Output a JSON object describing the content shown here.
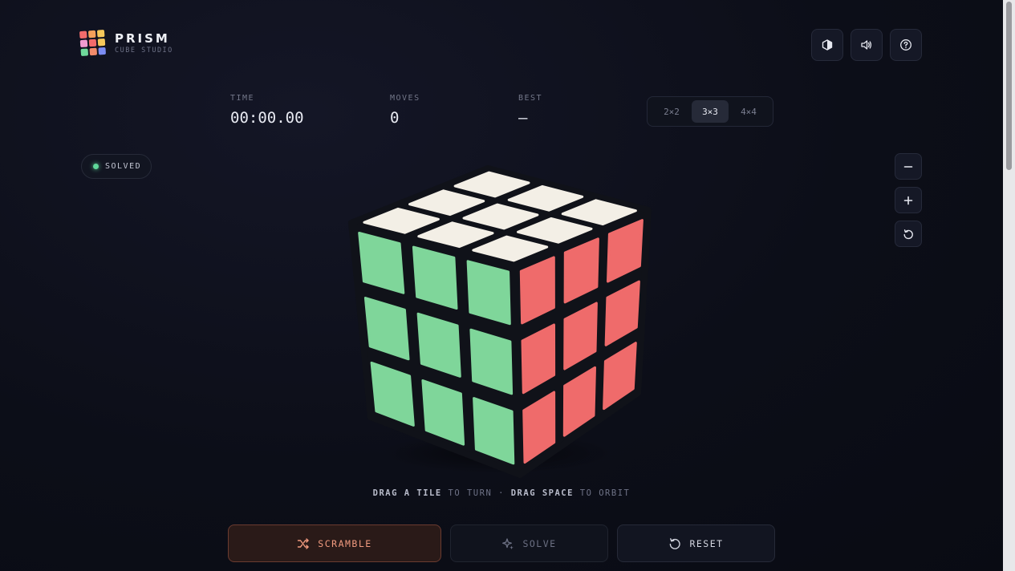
{
  "brand": {
    "title": "PRISM",
    "subtitle": "CUBE STUDIO",
    "logo_colors": [
      "#f26b6b",
      "#f5a05a",
      "#f5c85a",
      "#f29bd0",
      "#f26b6b",
      "#f5c85a",
      "#6fd99b",
      "#f28b6b",
      "#7b8cf2"
    ]
  },
  "top_icons": [
    "cube-view-icon",
    "sound-icon",
    "help-icon"
  ],
  "stats": {
    "time_label": "TIME",
    "time_value": "00:00.00",
    "moves_label": "MOVES",
    "moves_value": "0",
    "best_label": "BEST",
    "best_value": "—"
  },
  "size_options": [
    "2×2",
    "3×3",
    "4×4"
  ],
  "size_selected": "3×3",
  "status": {
    "label": "SOLVED",
    "color": "#5fd89a"
  },
  "zoom": [
    "zoom-out-icon",
    "zoom-in-icon",
    "reset-view-icon"
  ],
  "cube": {
    "size": 3,
    "faces": {
      "top": "#f3efe6",
      "left": "#7fd69a",
      "right": "#ef6b6b"
    },
    "gap_color": "#101219"
  },
  "hint": {
    "part1": "DRAG A TILE",
    "part2": " TO TURN · ",
    "part3": "DRAG SPACE",
    "part4": " TO ORBIT"
  },
  "actions": {
    "scramble": "SCRAMBLE",
    "solve": "SOLVE",
    "reset": "RESET"
  },
  "colors": {
    "accent": "#f19a7f",
    "background": "#0c0e18"
  }
}
